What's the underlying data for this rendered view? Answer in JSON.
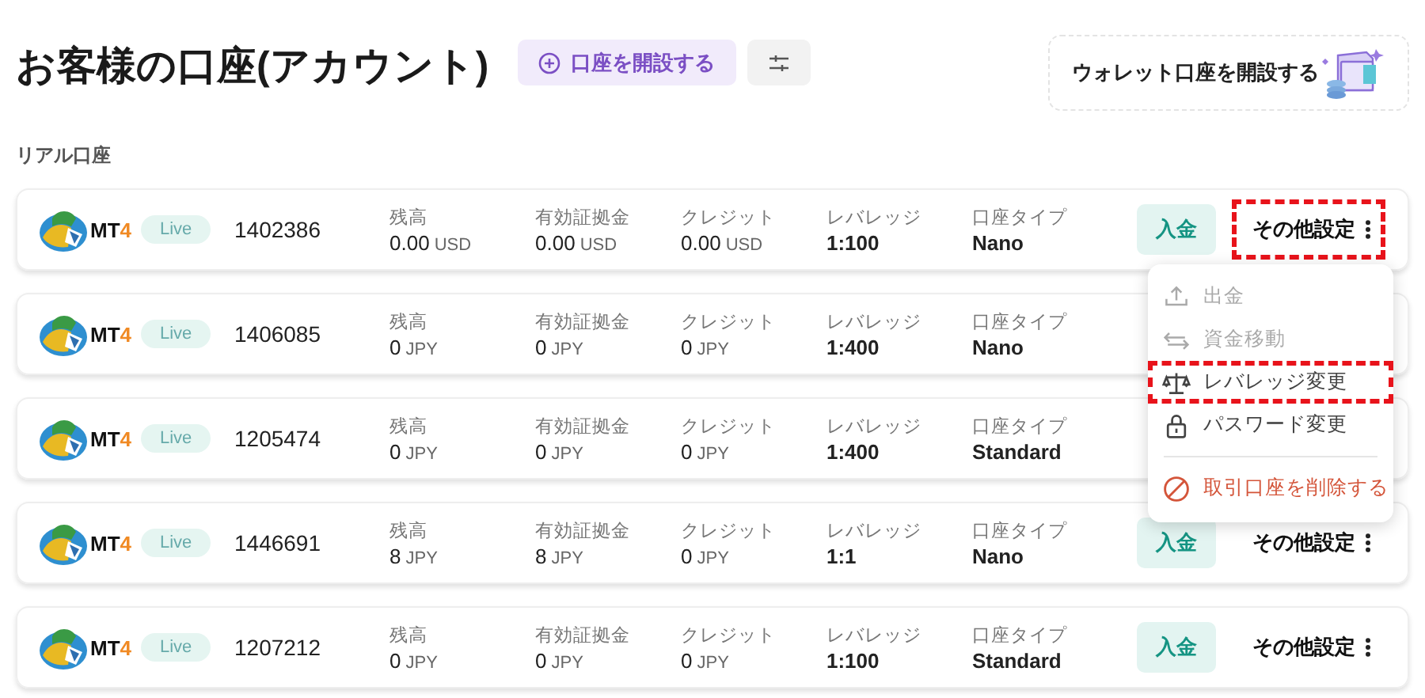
{
  "header": {
    "title": "お客様の口座(アカウント)",
    "open_account_button": "口座を開設する",
    "wallet_card": "ウォレット口座を開設する"
  },
  "section_title": "リアル口座",
  "accounts": [
    {
      "platform": "MT",
      "platform_version": "4",
      "badge": "Live",
      "number": "1402386",
      "fields": [
        {
          "label": "残高",
          "value": "0.00",
          "unit": "USD"
        },
        {
          "label": "有効証拠金",
          "value": "0.00",
          "unit": "USD"
        },
        {
          "label": "クレジット",
          "value": "0.00",
          "unit": "USD"
        },
        {
          "label": "レバレッジ",
          "value": "1:100"
        },
        {
          "label": "口座タイプ",
          "value": "Nano"
        }
      ],
      "deposit_button": "入金",
      "more_button": {
        "label": "その他設定",
        "highlighted": true
      }
    },
    {
      "platform": "MT",
      "platform_version": "4",
      "badge": "Live",
      "number": "1406085",
      "fields": [
        {
          "label": "残高",
          "value": "0",
          "unit": "JPY"
        },
        {
          "label": "有効証拠金",
          "value": "0",
          "unit": "JPY"
        },
        {
          "label": "クレジット",
          "value": "0",
          "unit": "JPY"
        },
        {
          "label": "レバレッジ",
          "value": "1:400"
        },
        {
          "label": "口座タイプ",
          "value": "Nano"
        }
      ]
    },
    {
      "platform": "MT",
      "platform_version": "4",
      "badge": "Live",
      "number": "1205474",
      "fields": [
        {
          "label": "残高",
          "value": "0",
          "unit": "JPY"
        },
        {
          "label": "有効証拠金",
          "value": "0",
          "unit": "JPY"
        },
        {
          "label": "クレジット",
          "value": "0",
          "unit": "JPY"
        },
        {
          "label": "レバレッジ",
          "value": "1:400"
        },
        {
          "label": "口座タイプ",
          "value": "Standard"
        }
      ]
    },
    {
      "platform": "MT",
      "platform_version": "4",
      "badge": "Live",
      "number": "1446691",
      "fields": [
        {
          "label": "残高",
          "value": "8",
          "unit": "JPY"
        },
        {
          "label": "有効証拠金",
          "value": "8",
          "unit": "JPY"
        },
        {
          "label": "クレジット",
          "value": "0",
          "unit": "JPY"
        },
        {
          "label": "レバレッジ",
          "value": "1:1"
        },
        {
          "label": "口座タイプ",
          "value": "Nano"
        }
      ],
      "deposit_button": "入金",
      "more_button": {
        "label": "その他設定",
        "highlighted": false
      }
    },
    {
      "platform": "MT",
      "platform_version": "4",
      "badge": "Live",
      "number": "1207212",
      "fields": [
        {
          "label": "残高",
          "value": "0",
          "unit": "JPY"
        },
        {
          "label": "有効証拠金",
          "value": "0",
          "unit": "JPY"
        },
        {
          "label": "クレジット",
          "value": "0",
          "unit": "JPY"
        },
        {
          "label": "レバレッジ",
          "value": "1:100"
        },
        {
          "label": "口座タイプ",
          "value": "Standard"
        }
      ],
      "deposit_button": "入金",
      "more_button": {
        "label": "その他設定",
        "highlighted": false
      }
    }
  ],
  "menu": {
    "items": [
      {
        "kind": "upload",
        "label": "出金",
        "disabled": true,
        "highlighted": false
      },
      {
        "kind": "transfer",
        "label": "資金移動",
        "disabled": true,
        "highlighted": false
      },
      {
        "kind": "scale",
        "label": "レバレッジ変更",
        "disabled": false,
        "highlighted": true
      },
      {
        "kind": "lock",
        "label": "パスワード変更",
        "disabled": false,
        "highlighted": false
      },
      {
        "kind": "delete",
        "label": "取引口座を削除する",
        "disabled": false,
        "highlighted": false
      }
    ]
  }
}
